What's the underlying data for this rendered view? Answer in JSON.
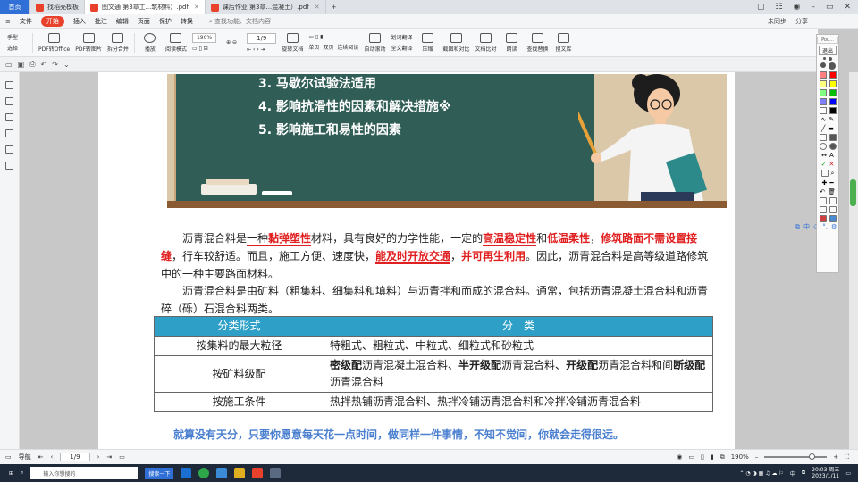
{
  "tabs": [
    {
      "label": "首页",
      "active": false,
      "home": true
    },
    {
      "label": "找稻壳模板",
      "active": false,
      "color": "#e8412c"
    },
    {
      "label": "图文通 第3章工...筑材料）.pdf",
      "active": true,
      "color": "#e8412c"
    },
    {
      "label": "课后作业 第3章...混凝土）.pdf",
      "active": false,
      "color": "#e8412c"
    }
  ],
  "tab_add": "+",
  "menu": {
    "items": [
      "文件",
      "开始",
      "插入",
      "批注",
      "编辑",
      "页面",
      "保护",
      "转换"
    ],
    "search": "查找功能、文档内容",
    "right": [
      "未同步",
      "分享"
    ]
  },
  "toolbar": {
    "hand": "手型",
    "select": "选择",
    "pdf_office": "PDF转Office",
    "pdf_image": "PDF转图片",
    "split_merge": "拆分合并",
    "play": "播放",
    "read_mode": "阅读模式",
    "zoom": "190%",
    "rotate": "旋转文档",
    "single": "单页",
    "double": "双页",
    "continuous": "连续阅读",
    "auto_scroll": "自动滚动",
    "translate": "划词翻译",
    "full_translate": "全文翻译",
    "compress": "压缩",
    "screenshot": "截图和对比",
    "doc_compare": "文档比对",
    "read_aloud": "朗读",
    "find_replace": "查找替换",
    "search_lib": "搜文库",
    "page_indicator": "1/9"
  },
  "board": {
    "lines": [
      "3. 马歇尔试验法适用",
      "4. 影响抗滑性的因素和解决措施※",
      "5. 影响施工和易性的因素"
    ]
  },
  "para1": {
    "a": "沥青混合料是",
    "b": "一种",
    "c": "黏弹塑性",
    "d": "材料",
    "e": "，具有良好的力学性能，一定的",
    "f": "高温稳定性",
    "g": "和",
    "h": "低温柔性",
    "i": "，",
    "j": "修筑路面不需设置接缝",
    "k": "，行车较舒适。而且，施工方便、速度快，",
    "l": "能及时开放交通",
    "m": "，",
    "n": "并可再生利用",
    "o": "。因此，沥青混合料是高等级道路修筑中的一种主要路面材料。"
  },
  "para2": "沥青混合料是由矿料（粗集料、细集料和填料）与沥青拌和而成的混合料。通常，包括沥青混凝土混合料和沥青碎（砾）石混合料两类。",
  "table": {
    "headers": [
      "分类形式",
      "分　类"
    ],
    "rows": [
      {
        "form": "按集料的最大粒径",
        "content": "特粗式、粗粒式、中粒式、细粒式和砂粒式"
      },
      {
        "form": "按矿料级配",
        "b1": "密级配",
        "t1": "沥青混凝土混合料、",
        "b2": "半开级配",
        "t2": "沥青混合料、",
        "b3": "开级配",
        "t3": "沥青混合料和间",
        "b4": "断级配",
        "t4": "沥青混合料"
      },
      {
        "form": "按施工条件",
        "content": "热拌热铺沥青混合料、热拌冷铺沥青混合料和冷拌冷铺沥青混合料"
      }
    ]
  },
  "motto": "就算没有天分，只要你愿意每天花一点时间，做同样一件事情，不知不觉间，你就会走得很远。",
  "annot": {
    "title": "Pou...",
    "exit": "退出"
  },
  "lang_widget": {
    "label": "中"
  },
  "status": {
    "nav": "导航",
    "page": "1/9",
    "zoom": "190%"
  },
  "taskbar": {
    "search_placeholder": "输入你想搜的",
    "search_button": "搜索一下",
    "ime": "中",
    "time": "20:03 周三",
    "date": "2023/1/11"
  },
  "colors": {
    "accent": "#2f6fd6",
    "start": "#e8412c",
    "board": "#305e56",
    "header_cell": "#2ea0c8",
    "motto": "#4a7fd0",
    "highlight": "#e02020"
  }
}
